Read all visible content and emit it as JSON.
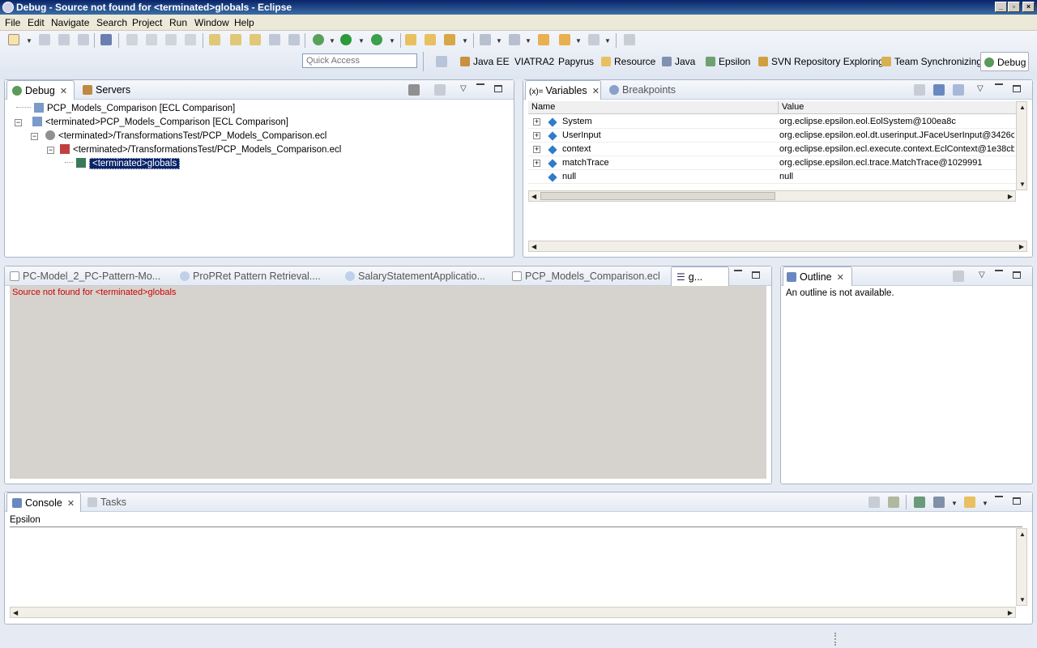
{
  "window": {
    "title": "Debug - Source not found for <terminated>globals - Eclipse"
  },
  "menu": [
    "File",
    "Edit",
    "Navigate",
    "Search",
    "Project",
    "Run",
    "Window",
    "Help"
  ],
  "quick_access": {
    "placeholder": "Quick Access"
  },
  "perspectives": [
    "Java EE",
    "VIATRA2",
    "Papyrus",
    "Resource",
    "Java",
    "Epsilon",
    "SVN Repository Exploring",
    "Team Synchronizing",
    "Debug"
  ],
  "debug_view": {
    "tabs": [
      "Debug",
      "Servers"
    ],
    "tree": [
      "PCP_Models_Comparison [ECL Comparison]",
      "<terminated>PCP_Models_Comparison [ECL Comparison]",
      "<terminated>/TransformationsTest/PCP_Models_Comparison.ecl",
      "<terminated>/TransformationsTest/PCP_Models_Comparison.ecl",
      "<terminated>globals"
    ]
  },
  "variables_view": {
    "tabs": [
      "Variables",
      "Breakpoints"
    ],
    "headers": [
      "Name",
      "Value"
    ],
    "rows": [
      {
        "name": "System",
        "value": "org.eclipse.epsilon.eol.EolSystem@100ea8c"
      },
      {
        "name": "UserInput",
        "value": "org.eclipse.epsilon.eol.dt.userinput.JFaceUserInput@3426c"
      },
      {
        "name": "context",
        "value": "org.eclipse.epsilon.ecl.execute.context.EclContext@1e38cb"
      },
      {
        "name": "matchTrace",
        "value": "org.eclipse.epsilon.ecl.trace.MatchTrace@1029991"
      },
      {
        "name": "null",
        "value": "null"
      }
    ]
  },
  "editor": {
    "tabs": [
      "PC-Model_2_PC-Pattern-Mo...",
      "ProPRet Pattern Retrieval....",
      "SalaryStatementApplicatio...",
      "PCP_Models_Comparison.ecl",
      "g..."
    ],
    "message": "Source not found for <terminated>globals"
  },
  "outline": {
    "tab": "Outline",
    "message": "An outline is not available."
  },
  "console": {
    "tabs": [
      "Console",
      "Tasks"
    ],
    "label": "Epsilon"
  }
}
